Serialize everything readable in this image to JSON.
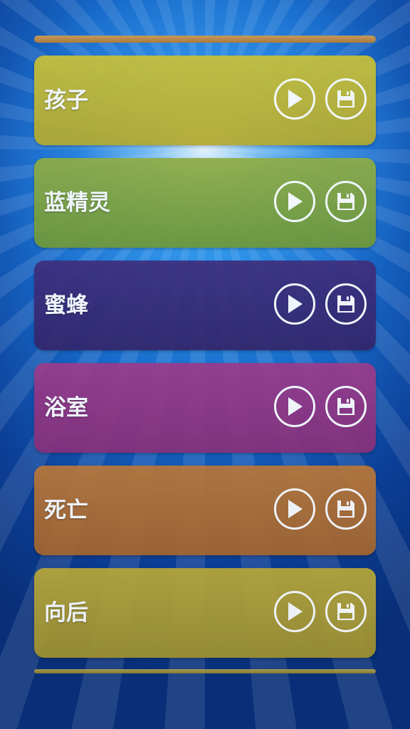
{
  "sounds": [
    {
      "label": "孩子",
      "color": "#c9c13a",
      "color_dark": "#b3a92f",
      "play_icon": "play-icon",
      "save_icon": "floppy-disk-icon"
    },
    {
      "label": "蓝精灵",
      "color": "#8fad45",
      "color_dark": "#6f9838",
      "play_icon": "play-icon",
      "save_icon": "floppy-disk-icon"
    },
    {
      "label": "蜜蜂",
      "color": "#3e2f7e",
      "color_dark": "#33266b",
      "play_icon": "play-icon",
      "save_icon": "floppy-disk-icon"
    },
    {
      "label": "浴室",
      "color": "#9a3c8c",
      "color_dark": "#86307a",
      "play_icon": "play-icon",
      "save_icon": "floppy-disk-icon"
    },
    {
      "label": "死亡",
      "color": "#b8773a",
      "color_dark": "#a4662f",
      "play_icon": "play-icon",
      "save_icon": "floppy-disk-icon"
    },
    {
      "label": "向后",
      "color": "#b7a73a",
      "color_dark": "#9f9130",
      "play_icon": "play-icon",
      "save_icon": "floppy-disk-icon"
    }
  ]
}
